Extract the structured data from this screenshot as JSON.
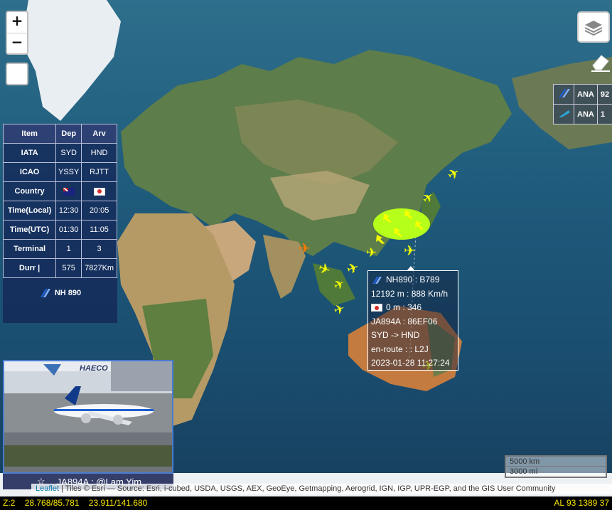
{
  "controls": {
    "zoom_in": "+",
    "zoom_out": "−"
  },
  "airlines": [
    {
      "code": "ANA",
      "count": "92",
      "color": "#1f5fd0"
    },
    {
      "code": "ANA",
      "count": "1",
      "color": "#2aa8d8"
    }
  ],
  "info_table": {
    "headers": [
      "Item",
      "Dep",
      "Arv"
    ],
    "rows": [
      {
        "label": "IATA",
        "dep": "SYD",
        "arv": "HND"
      },
      {
        "label": "ICAO",
        "dep": "YSSY",
        "arv": "RJTT"
      },
      {
        "label": "Country",
        "dep": "",
        "arv": ""
      },
      {
        "label": "Time(Local)",
        "dep": "12:30",
        "arv": "20:05"
      },
      {
        "label": "Time(UTC)",
        "dep": "01:30",
        "arv": "11:05"
      },
      {
        "label": "Terminal",
        "dep": "1",
        "arv": "3"
      },
      {
        "label": "Durr |",
        "dep": "575",
        "arv": "7827Km"
      }
    ],
    "flight": "NH 890"
  },
  "popup": {
    "flight": "NH890 : B789",
    "alt_speed": "12192 m : 888 Km/h",
    "misc": "0 m : 346",
    "reg": "JA894A : 86EF06",
    "route": "SYD -> HND",
    "status": "en-route : : L2J",
    "time": "2023-01-28 11:27:24"
  },
  "photo": {
    "caption": "JA894A : @Lam Yim",
    "hangar_text": "HAECO"
  },
  "scale": {
    "km": "5000 km",
    "mi": "3000 mi"
  },
  "attribution": {
    "leaflet": "Leaflet",
    "text": " | Tiles © Esri — Source: Esri, i-cubed, USDA, USGS, AEX, GeoEye, Getmapping, Aerogrid, IGN, IGP, UPR-EGP, and the GIS User Community"
  },
  "status_bar": {
    "zoom": "Z:2",
    "coord1": "28.768/85.781",
    "coord2": "23.911/141.680",
    "right": "AL  93   1389   37"
  }
}
